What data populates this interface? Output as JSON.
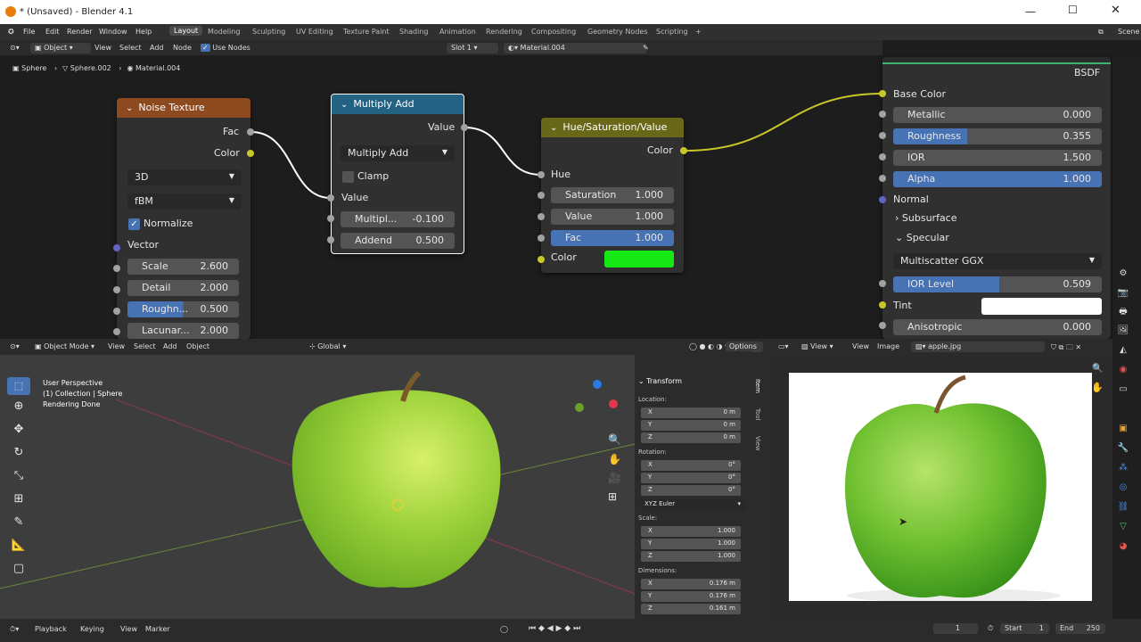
{
  "window": {
    "title": "* (Unsaved) - Blender 4.1"
  },
  "menu": [
    "File",
    "Edit",
    "Render",
    "Window",
    "Help"
  ],
  "workspaces": [
    "Layout",
    "Modeling",
    "Sculpting",
    "UV Editing",
    "Texture Paint",
    "Shading",
    "Animation",
    "Rendering",
    "Compositing",
    "Geometry Nodes",
    "Scripting"
  ],
  "scene_label": "Scene",
  "node_header": {
    "mode": "Object",
    "menus": [
      "View",
      "Select",
      "Add",
      "Node"
    ],
    "use_nodes": "Use Nodes",
    "slot": "Slot 1",
    "material": "Material.004"
  },
  "breadcrumb": [
    "Sphere",
    "Sphere.002",
    "Material.004"
  ],
  "noise": {
    "title": "Noise Texture",
    "fac": "Fac",
    "color": "Color",
    "dim": "3D",
    "type": "fBM",
    "normalize": "Normalize",
    "vector": "Vector",
    "fields": [
      {
        "label": "Scale",
        "value": "2.600"
      },
      {
        "label": "Detail",
        "value": "2.000"
      },
      {
        "label": "Roughn...",
        "value": "0.500"
      },
      {
        "label": "Lacunar...",
        "value": "2.000"
      }
    ]
  },
  "multiply": {
    "title": "Multiply Add",
    "out": "Value",
    "op": "Multiply Add",
    "clamp": "Clamp",
    "in": "Value",
    "fields": [
      {
        "label": "Multipl...",
        "value": "-0.100"
      },
      {
        "label": "Addend",
        "value": "0.500"
      }
    ]
  },
  "hsv": {
    "title": "Hue/Saturation/Value",
    "out": "Color",
    "hue": "Hue",
    "fields": [
      {
        "label": "Saturation",
        "value": "1.000"
      },
      {
        "label": "Value",
        "value": "1.000"
      },
      {
        "label": "Fac",
        "value": "1.000"
      }
    ],
    "color_label": "Color",
    "color_swatch": "#16e816"
  },
  "bsdf": {
    "title": "BSDF",
    "base_color": "Base Color",
    "fields": [
      {
        "label": "Metallic",
        "value": "0.000"
      },
      {
        "label": "Roughness",
        "value": "0.355",
        "fill": 0.355
      },
      {
        "label": "IOR",
        "value": "1.500"
      },
      {
        "label": "Alpha",
        "value": "1.000",
        "fill": 1.0
      }
    ],
    "normal": "Normal",
    "subsurface": "Subsurface",
    "specular": "Specular",
    "dist": "Multiscatter GGX",
    "ior_level": {
      "label": "IOR Level",
      "value": "0.509",
      "fill": 0.509
    },
    "tint": "Tint",
    "aniso": {
      "label": "Anisotropic",
      "value": "0.000"
    }
  },
  "viewport": {
    "mode": "Object Mode",
    "menus": [
      "View",
      "Select",
      "Add",
      "Object"
    ],
    "orient": "Global",
    "options": "Options",
    "overlay": [
      "User Perspective",
      "(1) Collection | Sphere",
      "Rendering Done"
    ]
  },
  "npanel": {
    "section": "Transform",
    "location": "Location:",
    "loc": [
      {
        "a": "X",
        "v": "0 m"
      },
      {
        "a": "Y",
        "v": "0 m"
      },
      {
        "a": "Z",
        "v": "0 m"
      }
    ],
    "rotation": "Rotation:",
    "rot": [
      {
        "a": "X",
        "v": "0°"
      },
      {
        "a": "Y",
        "v": "0°"
      },
      {
        "a": "Z",
        "v": "0°"
      }
    ],
    "euler": "XYZ Euler",
    "scale": "Scale:",
    "scl": [
      {
        "a": "X",
        "v": "1.000"
      },
      {
        "a": "Y",
        "v": "1.000"
      },
      {
        "a": "Z",
        "v": "1.000"
      }
    ],
    "dimensions": "Dimensions:",
    "dim": [
      {
        "a": "X",
        "v": "0.176 m"
      },
      {
        "a": "Y",
        "v": "0.176 m"
      },
      {
        "a": "Z",
        "v": "0.161 m"
      }
    ],
    "tabs": [
      "Item",
      "Tool",
      "View"
    ]
  },
  "image_editor": {
    "menus": [
      "View",
      "View",
      "Image"
    ],
    "image": "apple.jpg"
  },
  "timeline": {
    "menus": [
      "Playback",
      "Keying",
      "View",
      "Marker"
    ],
    "frame": "1",
    "start_label": "Start",
    "start": "1",
    "end_label": "End",
    "end": "250"
  }
}
